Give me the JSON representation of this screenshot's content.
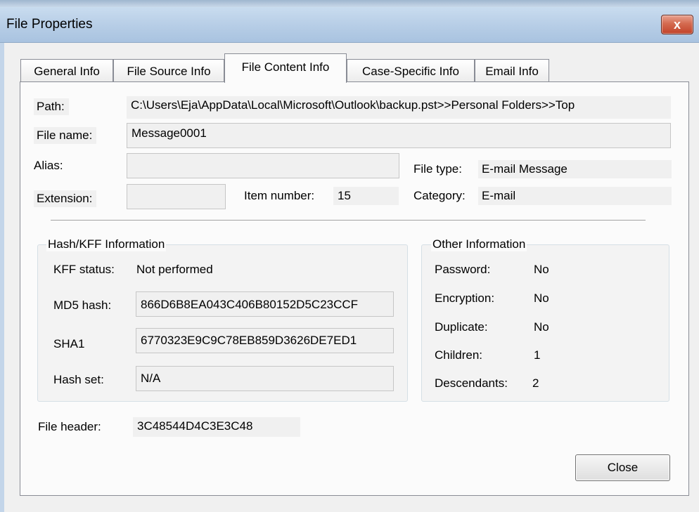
{
  "window": {
    "title": "File Properties",
    "close_glyph": "x"
  },
  "tabs": [
    {
      "label": "General Info",
      "active": false
    },
    {
      "label": "File Source Info",
      "active": false
    },
    {
      "label": "File Content Info",
      "active": true
    },
    {
      "label": "Case-Specific Info",
      "active": false
    },
    {
      "label": "Email Info",
      "active": false
    }
  ],
  "fields": {
    "path_label": "Path:",
    "path_value": "C:\\Users\\Eja\\AppData\\Local\\Microsoft\\Outlook\\backup.pst>>Personal Folders>>Top",
    "filename_label": "File name:",
    "filename_value": "Message0001",
    "alias_label": "Alias:",
    "alias_value": "",
    "extension_label": "Extension:",
    "extension_value": "",
    "item_number_label": "Item number:",
    "item_number_value": "15",
    "file_type_label": "File type:",
    "file_type_value": "E-mail Message",
    "category_label": "Category:",
    "category_value": "E-mail"
  },
  "hash_group": {
    "title": "Hash/KFF Information",
    "kff_label": "KFF status:",
    "kff_value": "Not performed",
    "md5_label": "MD5 hash:",
    "md5_value": "866D6B8EA043C406B80152D5C23CCF",
    "sha1_label": "SHA1",
    "sha1_value": "6770323E9C9C78EB859D3626DE7ED1",
    "hashset_label": "Hash set:",
    "hashset_value": "N/A"
  },
  "other_group": {
    "title": "Other Information",
    "password_label": "Password:",
    "password_value": "No",
    "encryption_label": "Encryption:",
    "encryption_value": "No",
    "duplicate_label": "Duplicate:",
    "duplicate_value": "No",
    "children_label": "Children:",
    "children_value": "1",
    "descendants_label": "Descendants:",
    "descendants_value": "2"
  },
  "file_header_label": "File header:",
  "file_header_value": "3C48544D4C3E3C48",
  "close_button_label": "Close",
  "colors": {
    "title_bar": "#b6cde6",
    "close_x": "#c8523a",
    "panel": "#fbfbfb",
    "field": "#f0f0f0"
  }
}
